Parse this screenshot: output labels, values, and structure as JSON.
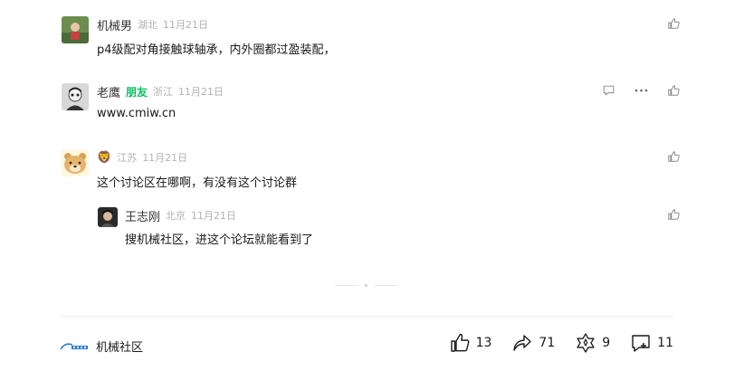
{
  "comments": [
    {
      "nickname": "机械男",
      "location": "湖北",
      "date": "11月21日",
      "content": "p4级配对角接触球轴承，内外圈都过盈装配，"
    },
    {
      "nickname": "老鹰",
      "tag": "朋友",
      "location": "浙江",
      "date": "11月21日",
      "content": "www.cmiw.cn"
    },
    {
      "nickname": "🦁",
      "location": "江苏",
      "date": "11月21日",
      "content": "这个讨论区在哪啊，有没有这个讨论群",
      "reply": {
        "nickname": "王志刚",
        "location": "北京",
        "date": "11月21日",
        "content": "搜机械社区，进这个论坛就能看到了"
      }
    }
  ],
  "footer": {
    "account_name": "机械社区",
    "likes": "13",
    "shares": "71",
    "recommends": "9",
    "comments": "11"
  },
  "colors": {
    "friend_tag": "#07c160",
    "meta_gray": "#b2b2b2",
    "icon_gray": "#888888"
  }
}
